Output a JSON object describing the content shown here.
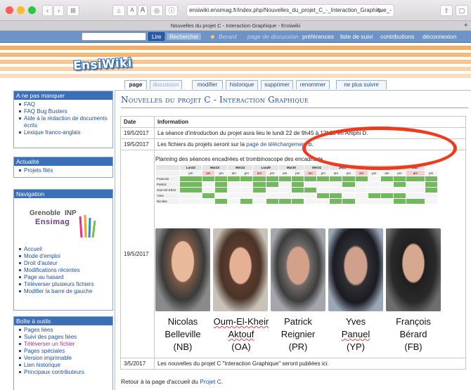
{
  "browser": {
    "nav_back": "‹",
    "nav_forward": "›",
    "sidebar_toggle": "⊞",
    "home": "⌂",
    "text_smaller": "A",
    "text_larger": "A",
    "circle_icon": "◎",
    "info_icon": "ⓘ",
    "url": "ensiwiki.ensimag.fr/index.php/Nouvelles_du_projet_C_-_Interaction_Graphique_-",
    "reload": "↻",
    "share": "⇧",
    "tab_title": "Nouvelles du projet C - Interaction Graphique - Ensiwiki",
    "new_tab": "+"
  },
  "topnav": {
    "search_placeholder": "",
    "lire": "Lire",
    "rechercher": "Rechercher",
    "user": "Berard",
    "discussion": "page de discussion",
    "preferences": "préférences",
    "suivi": "liste de suivi",
    "contributions": "contributions",
    "deconnexion": "déconnexion"
  },
  "logo": "EnsiWiki",
  "page_tabs": [
    "page",
    "discussion",
    "modifier",
    "historique",
    "supprimer",
    "renommer",
    "ne plus suivre"
  ],
  "sidebar": {
    "box1": {
      "title": "A ne pas manquer",
      "items": [
        "FAQ",
        "FAQ Bug Busters",
        "Aide à la rédaction de documents écrits",
        "Lexique franco-anglais"
      ]
    },
    "box2": {
      "title": "Actualité",
      "items": [
        "Projets filés"
      ]
    },
    "box3": {
      "title": "Navigation",
      "logo1": "Grenoble",
      "logo2": "INP",
      "logo3": "Ensimag",
      "items": [
        "Accueil",
        "Mode d'emploi",
        "Droit d'auteur",
        "Modifications récentes",
        "Page au hasard",
        "Téléverser plusieurs fichiers",
        "Modifier la barre de gauche"
      ]
    },
    "box4": {
      "title": "Boîte à outils",
      "items": [
        "Pages liées",
        "Suivi des pages liées",
        "Téléverser un fichier",
        "Pages spéciales",
        "Version imprimable",
        "Lien historique",
        "Principaux contributeurs"
      ]
    }
  },
  "content": {
    "title": "Nouvelles du projet C - Interaction Graphique",
    "col_date": "Date",
    "col_info": "Information",
    "row1_date": "19/5/2017",
    "row1_info": "La séance d'introduction du projet aura lieu le lundi 22 de 9h45 à 12h15 en Amphi D.",
    "row2_date": "19/5/2017",
    "row2_info_pre": "Les fichiers du projets seront sur la ",
    "row2_link": "page de téléchargement",
    "row3_date": "19/5/2017",
    "planning": "Planning des séances encadrées et trombinoscope des encadrants",
    "row4_date": "3/5/2017",
    "row4_info": "Les nouvelles du projet C \"Interaction Graphique\" seront publiées ici.",
    "footer_pre": "Retour à la page d'accueil du ",
    "footer_link": "Projet C",
    "footer_post": "."
  },
  "schedule": {
    "days": [
      "Lun22",
      "Mar23",
      "Mer24",
      "Lun29",
      "Mar30",
      "Mer31",
      "Jeu1",
      "Ven2",
      "Mar6",
      "Mar7"
    ],
    "ampm": [
      "pm",
      "am",
      "pm",
      "am",
      "pm",
      "am",
      "pm",
      "am",
      "pm",
      "am",
      "pm",
      "am",
      "pm",
      "am",
      "pm",
      "am",
      "pm",
      "am",
      "pm"
    ],
    "rows": [
      {
        "name": "Francois",
        "cells": [
          1,
          1,
          1,
          1,
          1,
          1,
          1,
          1,
          1,
          1,
          1,
          1,
          1,
          1,
          0,
          1,
          1,
          1,
          1
        ]
      },
      {
        "name": "Patrick",
        "cells": [
          1,
          0,
          1,
          0,
          0,
          1,
          1,
          0,
          1,
          0,
          0,
          0,
          1,
          0,
          0,
          0,
          1,
          0,
          1
        ]
      },
      {
        "name": "Oum-El-Kheir",
        "cells": [
          1,
          0,
          1,
          0,
          0,
          1,
          0,
          0,
          1,
          1,
          0,
          0,
          0,
          0,
          0,
          0,
          0,
          0,
          1
        ]
      },
      {
        "name": "Yves",
        "cells": [
          0,
          1,
          0,
          0,
          0,
          0,
          0,
          0,
          0,
          0,
          1,
          1,
          0,
          0,
          1,
          1,
          1,
          0,
          0
        ]
      },
      {
        "name": "Nicolas",
        "cells": [
          0,
          0,
          1,
          0,
          1,
          0,
          1,
          1,
          1,
          0,
          0,
          1,
          1,
          0,
          0,
          0,
          1,
          1,
          0
        ]
      }
    ]
  },
  "people": [
    {
      "first": "Nicolas",
      "last": "Belleville",
      "init": "(NB)"
    },
    {
      "first": "Oum-El-Kheir",
      "last": "Aktouf",
      "init": "(OA)"
    },
    {
      "first": "Patrick",
      "last": "Reignier",
      "init": "(PR)"
    },
    {
      "first": "Yves",
      "last": "Panuel",
      "init": "(YP)"
    },
    {
      "first": "François",
      "last": "Bérard",
      "init": "(FB)"
    }
  ],
  "colors": {
    "accent": "#3b6fb6",
    "green": "#73b85e",
    "annotation": "#f03a1e"
  }
}
